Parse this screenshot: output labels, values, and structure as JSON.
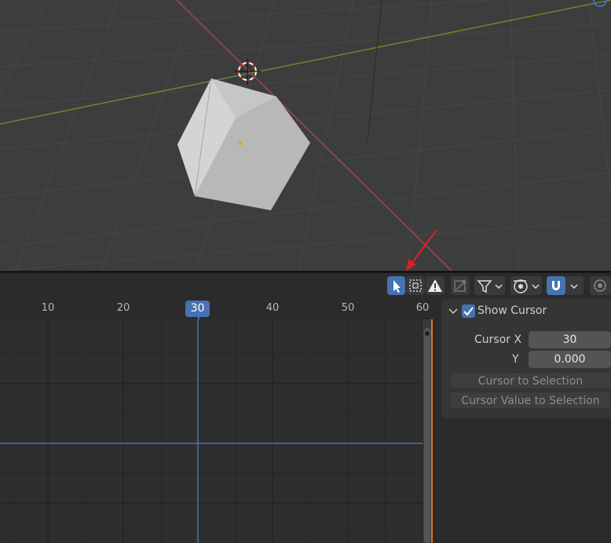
{
  "timeline": {
    "frames": [
      "10",
      "20",
      "30",
      "40",
      "50",
      "60"
    ],
    "current_frame": "30"
  },
  "header": {
    "icons": [
      "select-tool-icon",
      "box-select-icon",
      "warning-icon",
      "normalize-icon",
      "filter-icon",
      "chevron-down-icon",
      "proportional-edit-icon",
      "snap-magnet-icon",
      "overlay-icon"
    ]
  },
  "sidebar": {
    "show_cursor_label": "Show Cursor",
    "show_cursor_checked": true,
    "cursor_x_label": "Cursor X",
    "cursor_x_value": "30",
    "cursor_y_label": "Y",
    "cursor_y_value": "0.000",
    "cursor_to_selection": "Cursor to Selection",
    "cursor_value_to_selection": "Cursor Value to Selection"
  },
  "colors": {
    "accent": "#4772b3",
    "x_axis": "#a04550",
    "y_axis": "#6a8a30",
    "annotation_arrow": "#e02020"
  }
}
